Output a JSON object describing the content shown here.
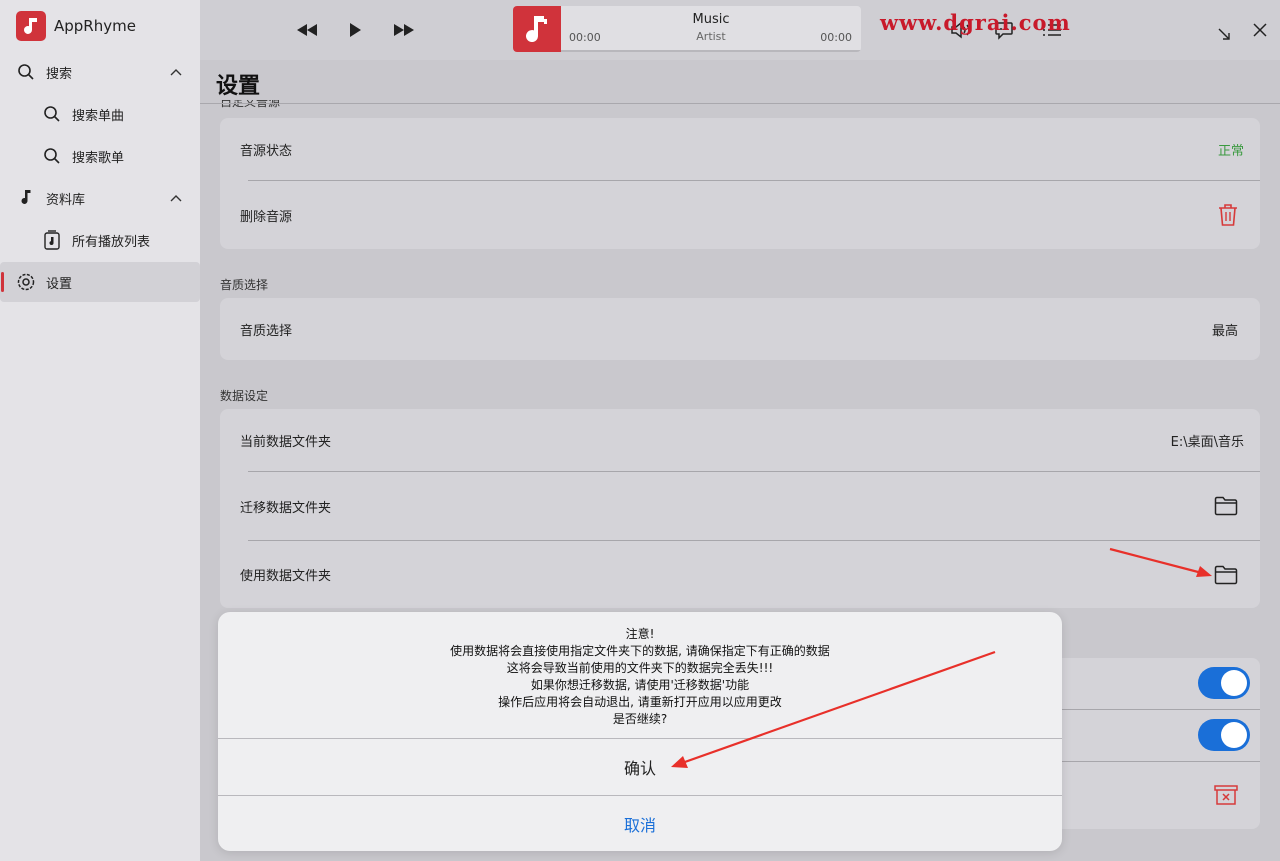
{
  "app": {
    "name": "AppRhyme"
  },
  "sidebar": {
    "items": [
      {
        "label": "搜索",
        "icon": "search-icon",
        "expanded": true
      },
      {
        "label": "搜索单曲",
        "icon": "search-icon"
      },
      {
        "label": "搜索歌单",
        "icon": "search-icon"
      },
      {
        "label": "资料库",
        "icon": "music-note-icon",
        "expanded": true
      },
      {
        "label": "所有播放列表",
        "icon": "playlist-icon"
      },
      {
        "label": "设置",
        "icon": "settings-icon",
        "active": true
      }
    ]
  },
  "player": {
    "title": "Music",
    "artist": "Artist",
    "current_time": "00:00",
    "total_time": "00:00"
  },
  "watermark": "www.dgrai.com",
  "page": {
    "title": "设置"
  },
  "sections": {
    "source_clipped_label": "自定义音源",
    "source_status_label": "音源状态",
    "source_status_value": "正常",
    "delete_source_label": "删除音源",
    "quality_header": "音质选择",
    "quality_label": "音质选择",
    "quality_value": "最高",
    "data_header": "数据设定",
    "current_folder_label": "当前数据文件夹",
    "current_folder_value": "E:\\桌面\\音乐",
    "migrate_folder_label": "迁移数据文件夹",
    "use_folder_label": "使用数据文件夹"
  },
  "dialog": {
    "lines": [
      "注意!",
      "使用数据将会直接使用指定文件夹下的数据, 请确保指定下有正确的数据",
      "这将会导致当前使用的文件夹下的数据完全丢失!!!",
      "如果你想迁移数据, 请使用'迁移数据'功能",
      "操作后应用将会自动退出, 请重新打开应用以应用更改",
      "是否继续?"
    ],
    "confirm_label": "确认",
    "cancel_label": "取消"
  },
  "colors": {
    "accent": "#d0333b",
    "status_ok": "#3a9a3f",
    "link_blue": "#1a6fd8",
    "annotation_red": "#e8302a"
  }
}
